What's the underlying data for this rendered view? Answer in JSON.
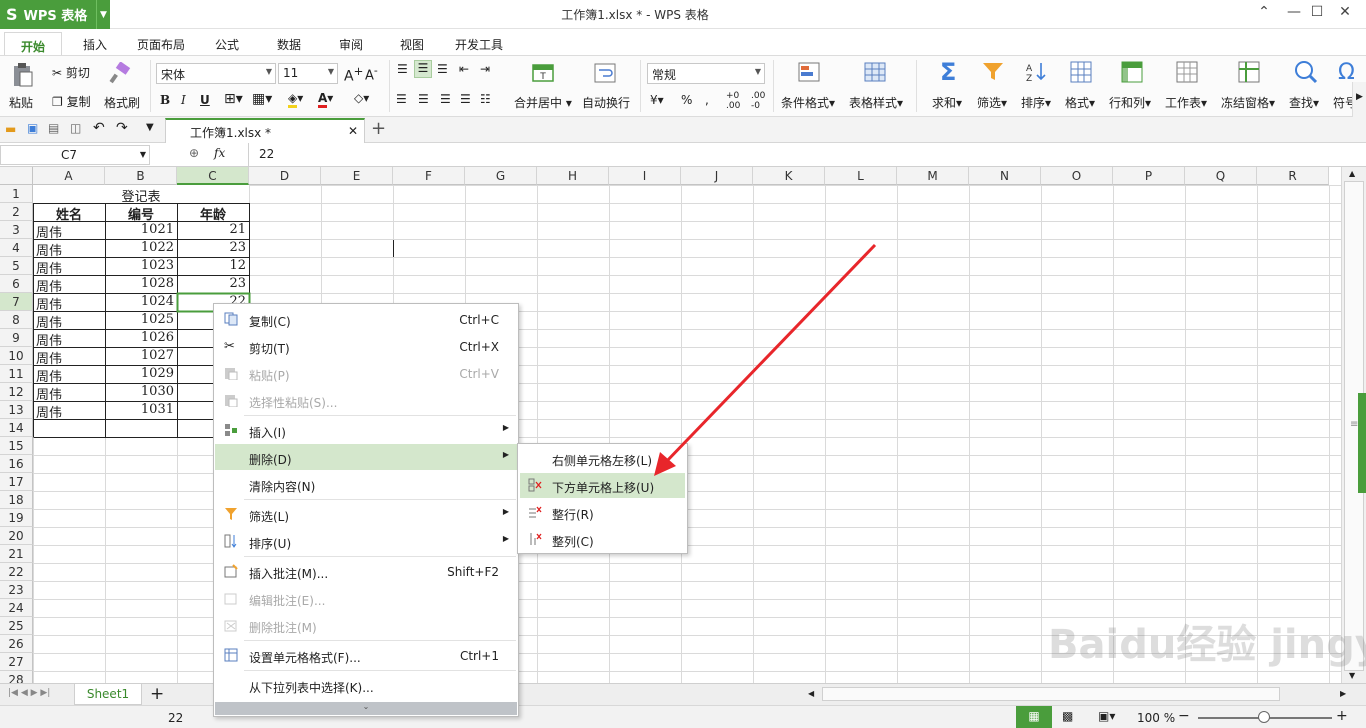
{
  "app": {
    "name": "WPS 表格",
    "title": "工作簿1.xlsx * - WPS 表格"
  },
  "menubar": [
    "开始",
    "插入",
    "页面布局",
    "公式",
    "数据",
    "审阅",
    "视图",
    "开发工具"
  ],
  "ribbon": {
    "paste": "粘贴",
    "cut": "剪切",
    "copy": "复制",
    "format_painter": "格式刷",
    "font": "宋体",
    "font_size": "11",
    "number_format": "常规",
    "merge_center": "合并居中",
    "wrap": "自动换行",
    "cond_format": "条件格式",
    "table_style": "表格样式",
    "sum": "求和",
    "filter": "筛选",
    "sort": "排序",
    "format": "格式",
    "rowcol": "行和列",
    "worksheet": "工作表",
    "freeze": "冻结窗格",
    "find": "查找",
    "symbol": "符号"
  },
  "doc_tab": "工作簿1.xlsx *",
  "formula": {
    "cell_ref": "C7",
    "fx": "fx",
    "value": "22"
  },
  "columns": [
    "A",
    "B",
    "C",
    "D",
    "E",
    "F",
    "G",
    "H",
    "I",
    "J",
    "K",
    "L",
    "M",
    "N",
    "O",
    "P",
    "Q",
    "R"
  ],
  "rows": [
    "1",
    "2",
    "3",
    "4",
    "5",
    "6",
    "7",
    "8",
    "9",
    "10",
    "11",
    "12",
    "13",
    "14",
    "15",
    "16",
    "17",
    "18",
    "19",
    "20",
    "21",
    "22",
    "23",
    "24",
    "25",
    "26",
    "27",
    "28"
  ],
  "sheet": {
    "title": "登记表",
    "headers": [
      "姓名",
      "编号",
      "年龄"
    ],
    "names": [
      "周伟",
      "周伟",
      "周伟",
      "周伟",
      "周伟",
      "周伟",
      "周伟",
      "周伟",
      "周伟",
      "周伟",
      "周伟"
    ],
    "ids": [
      "1021",
      "1022",
      "1023",
      "1028",
      "1024",
      "1025",
      "1026",
      "1027",
      "1029",
      "1030",
      "1031"
    ],
    "ages": [
      "21",
      "23",
      "12",
      "23",
      "22"
    ]
  },
  "context_menu": {
    "copy": "复制(C)",
    "copy_sc": "Ctrl+C",
    "cut": "剪切(T)",
    "cut_sc": "Ctrl+X",
    "paste": "粘贴(P)",
    "paste_sc": "Ctrl+V",
    "paste_special": "选择性粘贴(S)...",
    "insert": "插入(I)",
    "delete": "删除(D)",
    "clear": "清除内容(N)",
    "filter": "筛选(L)",
    "sort": "排序(U)",
    "insert_comment": "插入批注(M)...",
    "insert_comment_sc": "Shift+F2",
    "edit_comment": "编辑批注(E)...",
    "delete_comment": "删除批注(M)",
    "format_cells": "设置单元格格式(F)...",
    "format_cells_sc": "Ctrl+1",
    "pick_list": "从下拉列表中选择(K)..."
  },
  "submenu": {
    "shift_left": "右侧单元格左移(L)",
    "shift_up": "下方单元格上移(U)",
    "entire_row": "整行(R)",
    "entire_col": "整列(C)"
  },
  "sheet_tab": "Sheet1",
  "status": {
    "value": "22",
    "zoom": "100 %"
  },
  "watermark": "Baidu经验 jingyan.baidu.com",
  "colors": {
    "accent": "#4a9d3c",
    "arrow": "#e8262b"
  }
}
